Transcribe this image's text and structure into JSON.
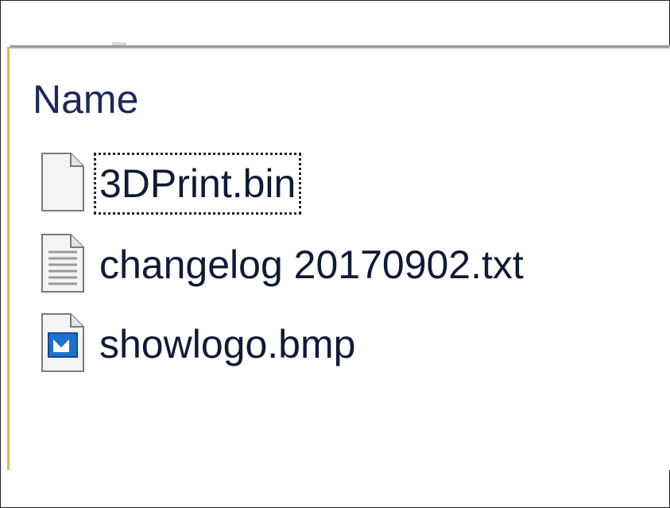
{
  "file_list": {
    "columns": [
      {
        "label": "Name"
      }
    ],
    "rows": [
      {
        "name": "3DPrint.bin",
        "icon": "blank-file-icon",
        "focused": true
      },
      {
        "name": "changelog 20170902.txt",
        "icon": "text-file-icon",
        "focused": false
      },
      {
        "name": "showlogo.bmp",
        "icon": "bitmap-file-icon",
        "focused": false
      }
    ]
  },
  "colors": {
    "text": "#0f1a36",
    "rail_accent": "#e0b64c",
    "bmp_icon_blue": "#1f6fd0"
  }
}
